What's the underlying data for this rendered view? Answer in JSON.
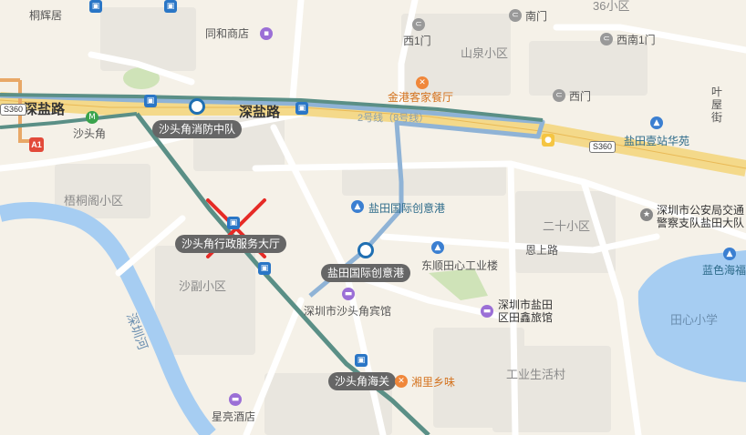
{
  "labels": {
    "tonghuiju": "桐辉居",
    "tonghe_shop": "同和商店",
    "xi1men": "西1门",
    "nanmen": "南门",
    "xinan1men": "西南1门",
    "shanquan": "山泉小区",
    "jinggang": "金港客家餐厅",
    "ximen": "西门",
    "shenyan_left": "深盐路",
    "shenyan_mid": "深盐路",
    "shatoujiao": "沙头角",
    "fire_station": "沙头角消防中队",
    "line2": "2号线（8号线）",
    "s360_left": "S360",
    "s360_right": "S360",
    "yantian_huayuan": "盐田壹站华苑",
    "ye_wu_jie": "叶屋街",
    "wutongge": "梧桐阁小区",
    "yantian_intl": "盐田国际创意港",
    "yantian_intl_pill": "盐田国际创意港",
    "ershi": "二十小区",
    "enshang": "恩上路",
    "police": "深圳市公安局交通警察支队盐田大队",
    "lanse": "蓝色海福",
    "admin_hall": "沙头角行政服务大厅",
    "dongshun": "东顺田心工业楼",
    "shafu": "沙副小区",
    "shenzhen_river": "深圳河",
    "binguan": "深圳市沙头角宾馆",
    "tianxin_school": "田心小学",
    "tianxin_hotel": "深圳市盐田区田鑫旅馆",
    "customs": "沙头角海关",
    "xiangli": "湘里乡味",
    "industrial": "工业生活村",
    "xingliang": "星亮酒店",
    "num36": "36小区"
  },
  "colors": {
    "background": "#f5f1e8",
    "road": "#ffffff",
    "highway": "#f4d98a",
    "metro": "#5a8f86",
    "bus_route": "#8fb3d6",
    "river": "#a6cdf2",
    "park": "#cfe3b8",
    "blocks": "#e9e6df",
    "cross": "#e62b26"
  },
  "icons": [
    "bus-icon",
    "metro-icon",
    "hotel-icon",
    "food-icon",
    "landmark-icon",
    "shop-icon",
    "gate-icon",
    "police-icon",
    "cross-marker-icon"
  ]
}
